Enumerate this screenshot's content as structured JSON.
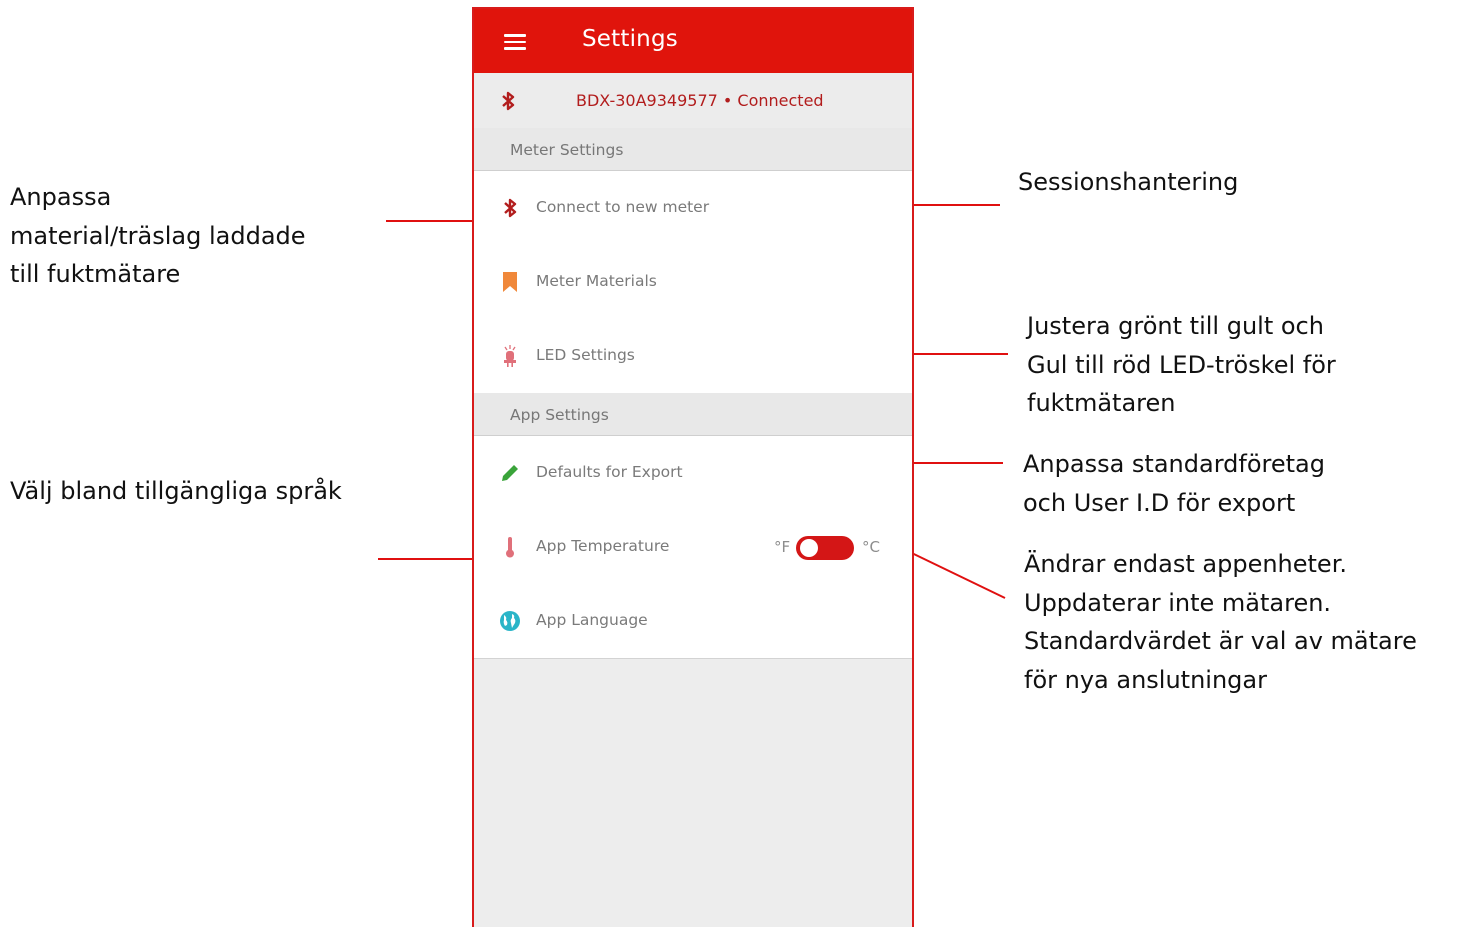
{
  "app_bar": {
    "title": "Settings",
    "menu_icon": "hamburger-menu-icon"
  },
  "device_status": {
    "icon": "bluetooth-icon",
    "text": "BDX-30A9349577 • Connected"
  },
  "meter_settings": {
    "header": "Meter Settings",
    "items": [
      {
        "label": "Connect to new meter",
        "icon": "bluetooth-icon"
      },
      {
        "label": "Meter Materials",
        "icon": "bookmark-icon"
      },
      {
        "label": "LED Settings",
        "icon": "led-icon"
      }
    ]
  },
  "app_settings": {
    "header": "App Settings",
    "items": [
      {
        "label": "Defaults for Export",
        "icon": "pencil-icon"
      },
      {
        "label": "App Temperature",
        "icon": "thermometer-icon",
        "unit_left": "°F",
        "unit_right": "°C"
      },
      {
        "label": "App Language",
        "icon": "globe-icon"
      }
    ]
  },
  "colors": {
    "accent": "#e0140c",
    "status_text": "#b21d1d",
    "bookmark": "#f0883a",
    "pencil": "#3aa43a",
    "globe": "#2bb5c8",
    "annotation_line": "#e01010"
  },
  "annotations": {
    "materials": "Anpassa\nmaterial/träslag laddade\ntill fuktmätare",
    "language": "Välj bland tillgängliga språk",
    "session": "Sessionshantering",
    "led": "Justera grönt till gult och\nGul till röd LED-tröskel för\n fuktmätaren",
    "export": "Anpassa standardföretag\noch User I.D för export",
    "temperature": "Ändrar  endast appenheter.\nUppdaterar inte  mätaren.\nStandardvärdet är val av mätare\nför nya anslutningar"
  }
}
